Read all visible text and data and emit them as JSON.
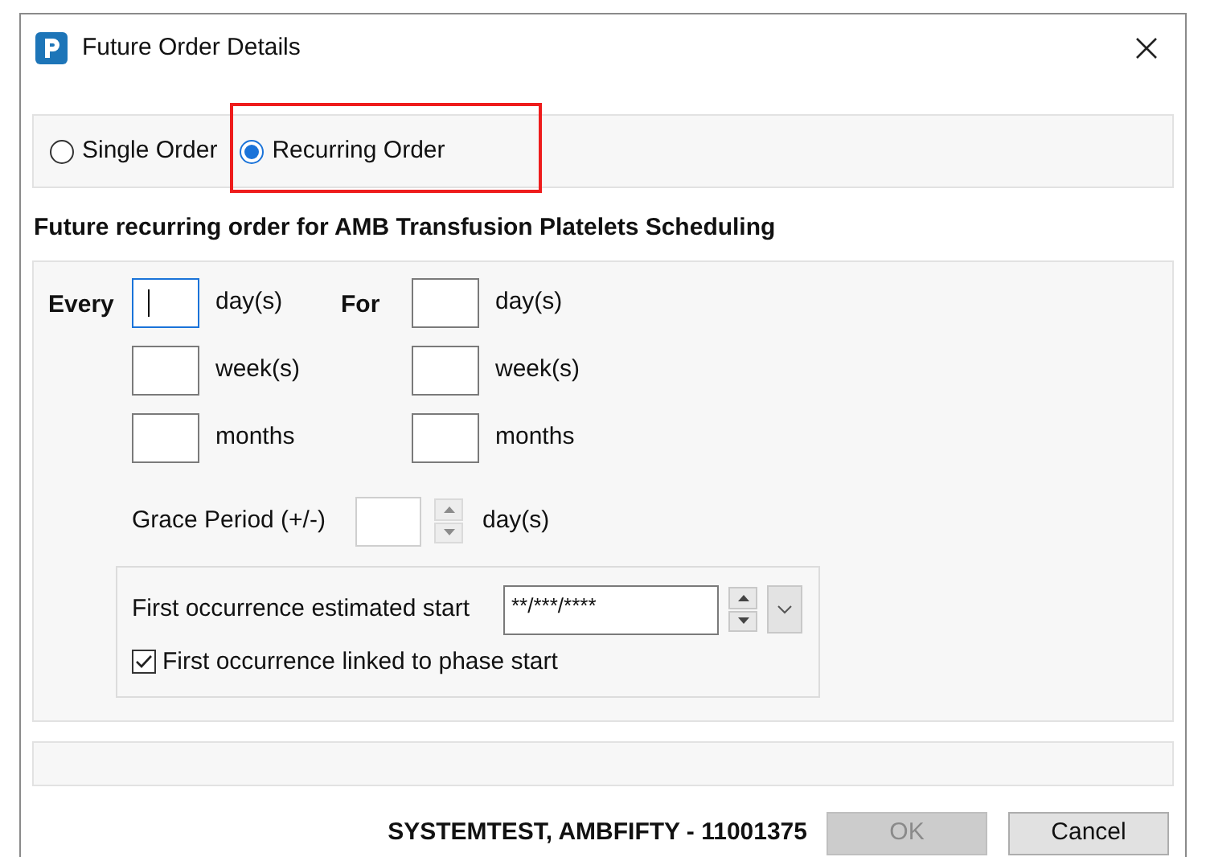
{
  "window": {
    "title": "Future Order Details"
  },
  "order_type": [
    {
      "label": "Single Order",
      "selected": false
    },
    {
      "label": "Recurring Order",
      "selected": true
    }
  ],
  "heading": "Future recurring order for AMB Transfusion Platelets Scheduling",
  "columns": [
    {
      "label": "Every",
      "fields": [
        {
          "unit": "day(s)",
          "focused": true
        },
        {
          "unit": "week(s)",
          "focused": false
        },
        {
          "unit": "months",
          "focused": false
        }
      ]
    },
    {
      "label": "For",
      "fields": [
        {
          "unit": "day(s)",
          "focused": false
        },
        {
          "unit": "week(s)",
          "focused": false
        },
        {
          "unit": "months",
          "focused": false
        }
      ]
    }
  ],
  "grace_period": {
    "label": "Grace Period (+/-)",
    "unit": "day(s)"
  },
  "first_occurrence": {
    "label": "First occurrence estimated start",
    "value": "**/***/****",
    "checkbox": {
      "label": "First occurrence linked to phase start",
      "checked": true
    }
  },
  "patient": "SYSTEMTEST, AMBFIFTY - 11001375",
  "buttons": [
    {
      "label": "OK",
      "disabled": true
    },
    {
      "label": "Cancel",
      "disabled": false
    }
  ]
}
